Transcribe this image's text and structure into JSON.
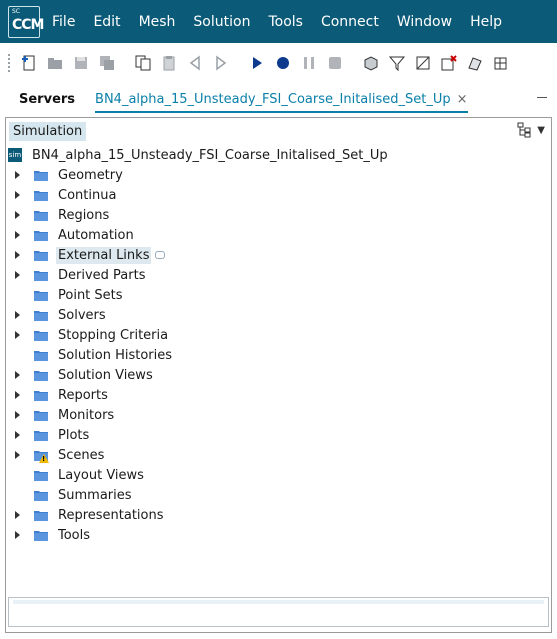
{
  "app": {
    "logo_sc": "SC",
    "logo_ccm": "CCM"
  },
  "menubar": {
    "items": [
      "File",
      "Edit",
      "Mesh",
      "Solution",
      "Tools",
      "Connect",
      "Window",
      "Help"
    ]
  },
  "toolbar": {
    "buttons": [
      "new-simulation-icon",
      "open-icon",
      "save-icon",
      "save-all-icon",
      "copy-icon",
      "paste-icon",
      "step-back-icon",
      "step-forward-icon",
      "run-icon",
      "record-icon",
      "pause-icon",
      "stop-icon",
      "mesh-icon",
      "filter-icon",
      "clear-mesh-icon",
      "delete-mesh-icon",
      "surface-icon",
      "volume-icon"
    ]
  },
  "tabs": {
    "servers": "Servers",
    "simulation_file": "BN4_alpha_15_Unsteady_FSI_Coarse_Initalised_Set_Up",
    "close": "×"
  },
  "panel": {
    "title": "Simulation",
    "root": "BN4_alpha_15_Unsteady_FSI_Coarse_Initalised_Set_Up",
    "nodes": [
      {
        "label": "Geometry",
        "expandable": true
      },
      {
        "label": "Continua",
        "expandable": true
      },
      {
        "label": "Regions",
        "expandable": true
      },
      {
        "label": "Automation",
        "expandable": true
      },
      {
        "label": "External Links",
        "expandable": true,
        "highlighted": true,
        "comment": true
      },
      {
        "label": "Derived Parts",
        "expandable": true
      },
      {
        "label": "Point Sets",
        "expandable": false
      },
      {
        "label": "Solvers",
        "expandable": true
      },
      {
        "label": "Stopping Criteria",
        "expandable": true
      },
      {
        "label": "Solution Histories",
        "expandable": false
      },
      {
        "label": "Solution Views",
        "expandable": true
      },
      {
        "label": "Reports",
        "expandable": true
      },
      {
        "label": "Monitors",
        "expandable": true
      },
      {
        "label": "Plots",
        "expandable": true
      },
      {
        "label": "Scenes",
        "expandable": true,
        "warning": true
      },
      {
        "label": "Layout Views",
        "expandable": false
      },
      {
        "label": "Summaries",
        "expandable": false
      },
      {
        "label": "Representations",
        "expandable": true
      },
      {
        "label": "Tools",
        "expandable": true
      }
    ]
  },
  "colors": {
    "menubar_bg": "#0a5a78",
    "accent": "#0a7fa8",
    "folder": "#3f7fd0",
    "warning": "#f2b900"
  }
}
